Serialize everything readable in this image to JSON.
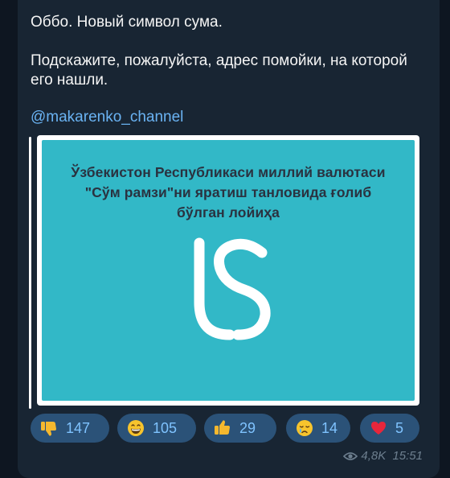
{
  "message": {
    "line1": "Оббо. Новый символ сума.",
    "line2": "Подскажите, пожалуйста, адрес помойки, на которой его нашли.",
    "channel_link": "@makarenko_channel",
    "image": {
      "title_line1": "Ўзбекистон Республикаси миллий валютаси",
      "title_line2": "\"Сўм рамзи\"ни яратиш танловида ғолиб",
      "title_line3": "бўлган лойиҳа",
      "background_color": "#32b8c7"
    },
    "reactions": [
      {
        "icon": "thumbs-down-icon",
        "count": "147"
      },
      {
        "icon": "grinning-face-icon",
        "count": "105"
      },
      {
        "icon": "thumbs-up-icon",
        "count": "29"
      },
      {
        "icon": "crying-face-icon",
        "count": "14"
      },
      {
        "icon": "red-heart-icon",
        "count": "5"
      }
    ],
    "views": "4,8K",
    "time": "15:51"
  },
  "colors": {
    "background": "#0e1621",
    "bubble": "#182533",
    "link": "#6ab3f3",
    "reaction_bg": "#2b5278",
    "reaction_text": "#7fc3ff"
  }
}
